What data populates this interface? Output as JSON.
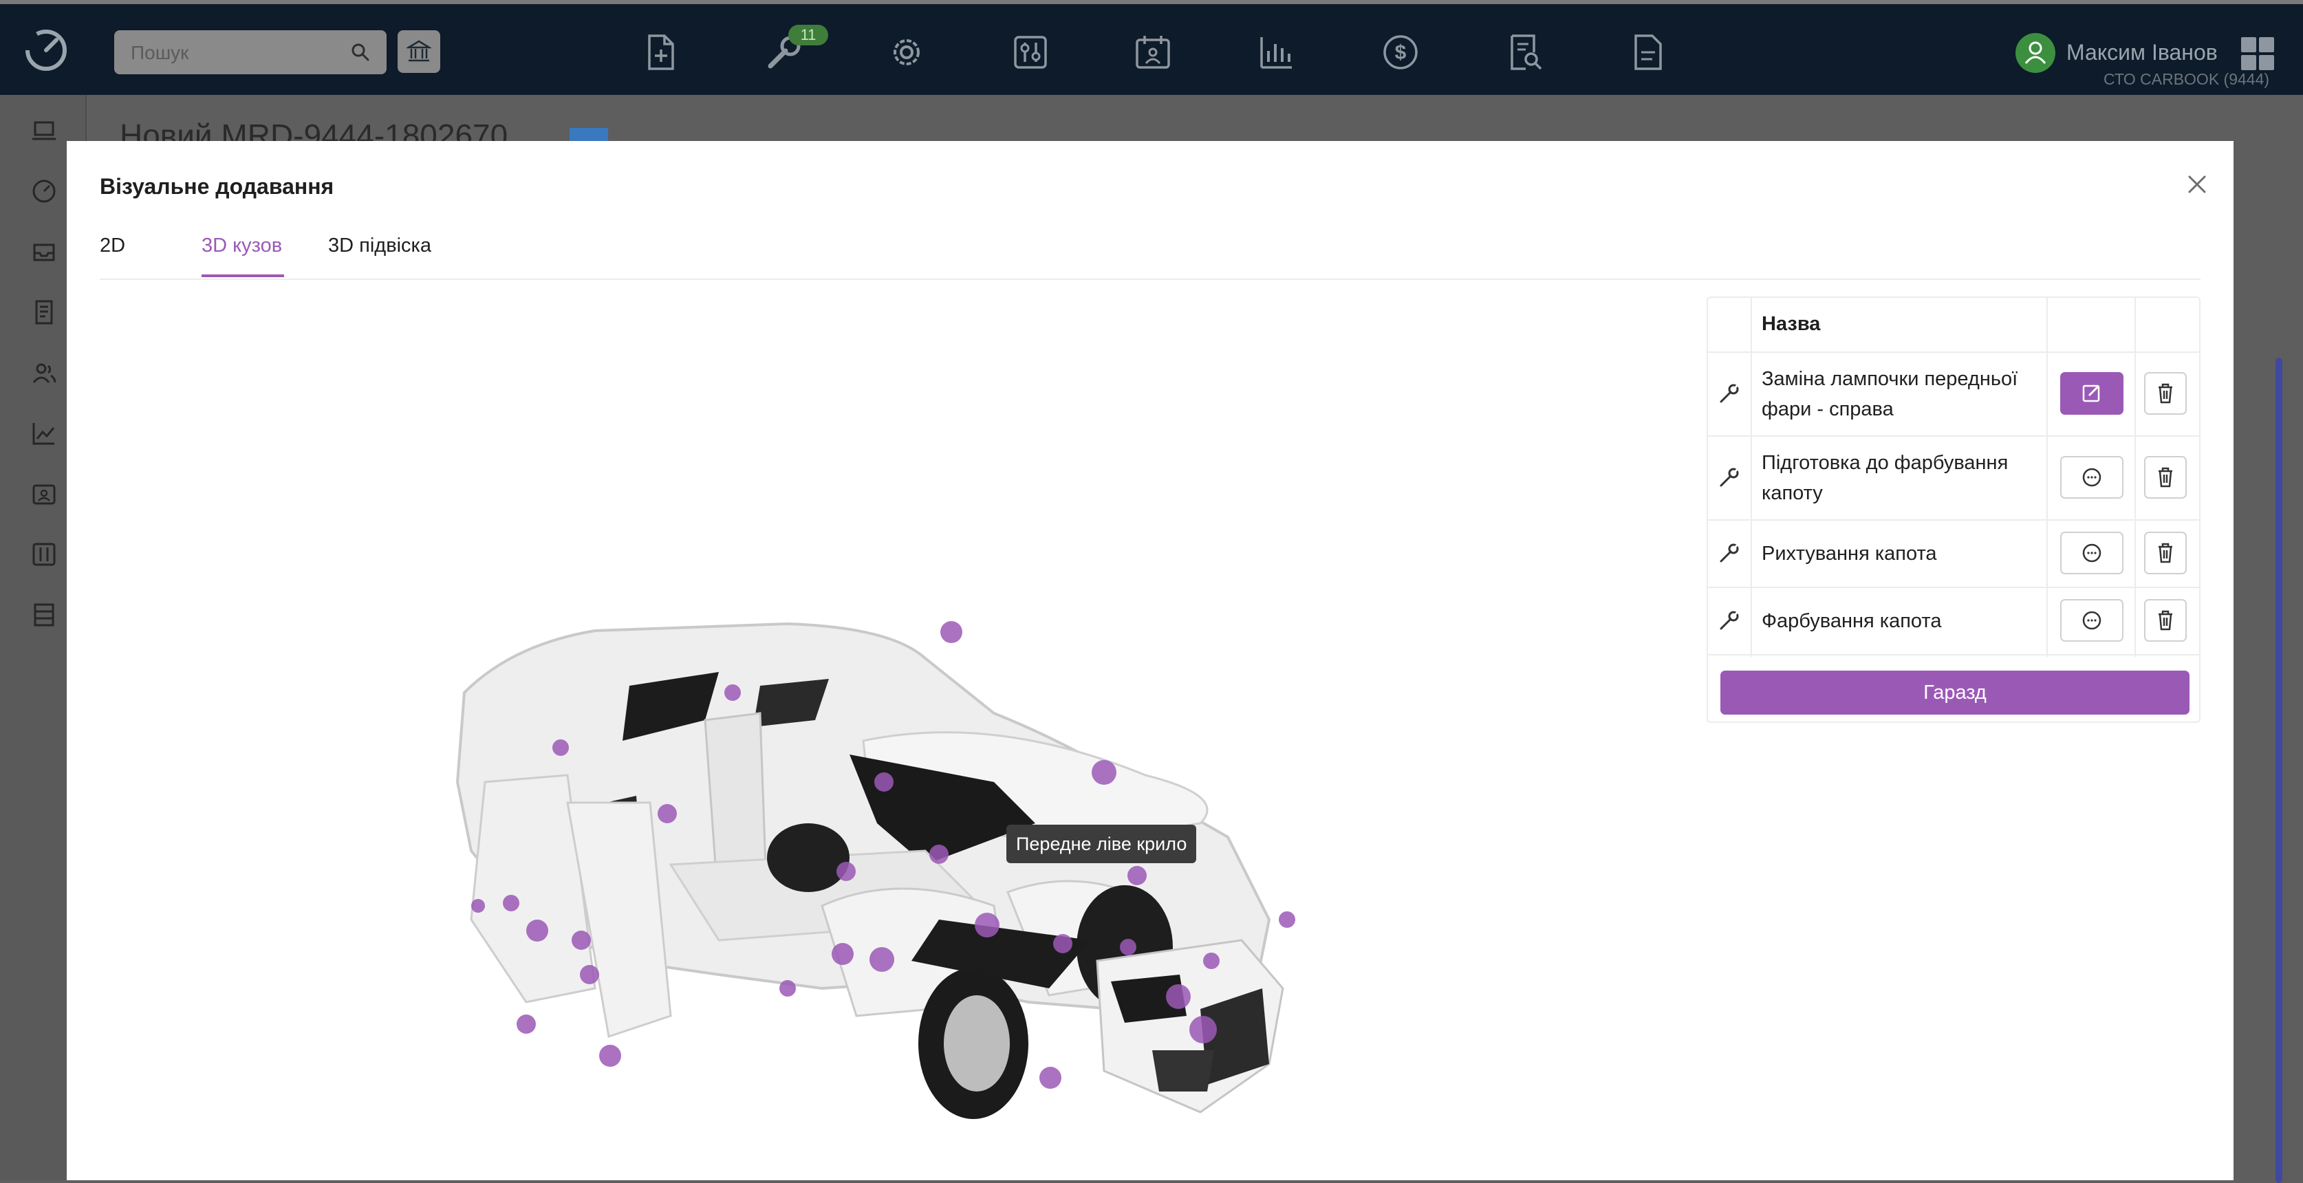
{
  "colors": {
    "accent": "#9b59b6",
    "topbar": "#0d1b2a",
    "overlay": "#5e5e5e",
    "marker": "#9b59b6"
  },
  "topbar": {
    "search": {
      "placeholder": "Пошук",
      "icon": "search-icon"
    },
    "bank_icon": "bank-icon",
    "nav_icons": [
      "file-plus-icon",
      "wrench-icon",
      "gear-icon",
      "sliders-icon",
      "calendar-user-icon",
      "bar-chart-icon",
      "dollar-icon",
      "document-search-icon",
      "document-icon"
    ],
    "wrench_badge": "11",
    "user": {
      "name": "Максим Іванов",
      "company": "СТО CARBOOK (9444)"
    },
    "apps_icon": "apps-grid-icon"
  },
  "sidebar": {
    "icons": [
      "laptop-icon",
      "dashboard-icon",
      "inbox-icon",
      "report-icon",
      "users-icon",
      "chart-line-icon",
      "contacts-icon",
      "settings-sliders-icon",
      "list-icon"
    ]
  },
  "background": {
    "title": "Новий MRD-9444-1802670"
  },
  "modal": {
    "title": "Візуальне додавання",
    "tabs": [
      {
        "label": "2D",
        "active": false
      },
      {
        "label": "3D кузов",
        "active": true
      },
      {
        "label": "3D підвіска",
        "active": false
      }
    ],
    "tooltip": "Передне ліве крило",
    "table": {
      "header": "Назва",
      "rows": [
        {
          "label": "Заміна лампочки передньої фари - справа",
          "action_icon": "edit-icon",
          "action_style": "primary"
        },
        {
          "label": "Підготовка до фарбування капоту",
          "action_icon": "comment-icon",
          "action_style": "outline"
        },
        {
          "label": "Рихтування капота",
          "action_icon": "comment-icon",
          "action_style": "outline"
        },
        {
          "label": "Фарбування капота",
          "action_icon": "comment-icon",
          "action_style": "outline"
        }
      ]
    },
    "ok_label": "Гаразд"
  }
}
